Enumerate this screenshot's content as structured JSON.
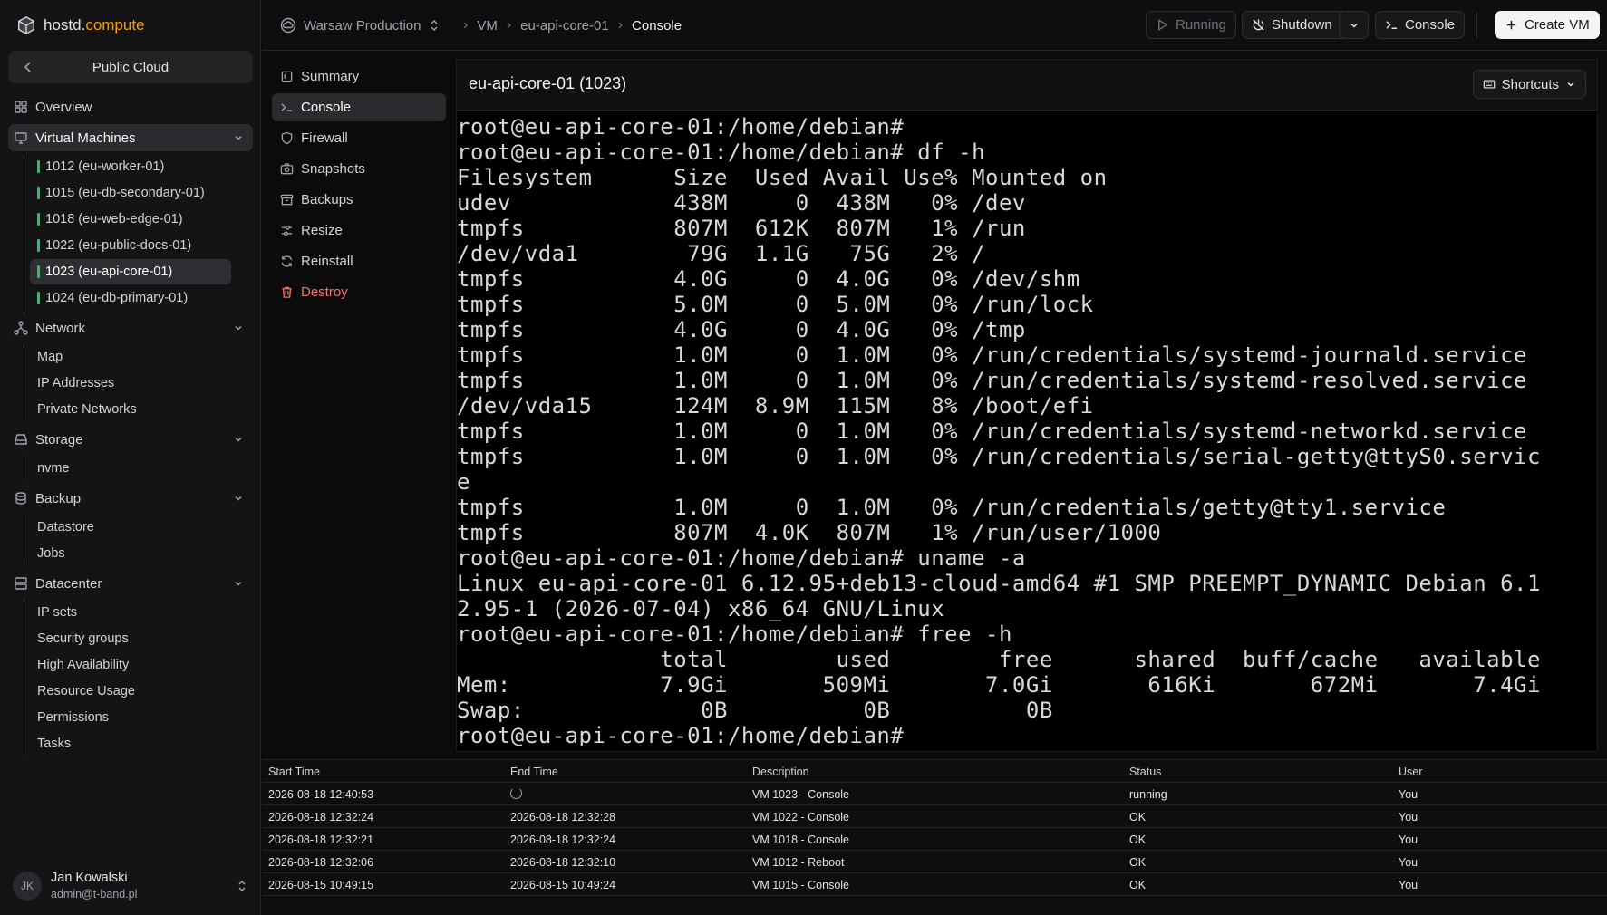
{
  "brand": {
    "name_a": "hostd.",
    "name_b": "compute"
  },
  "scope": {
    "label": "Public Cloud"
  },
  "sidebar": {
    "overview": "Overview",
    "virtual_machines": "Virtual Machines",
    "vms": [
      "1012 (eu-worker-01)",
      "1015 (eu-db-secondary-01)",
      "1018 (eu-web-edge-01)",
      "1022 (eu-public-docs-01)",
      "1023 (eu-api-core-01)",
      "1024 (eu-db-primary-01)"
    ],
    "network": "Network",
    "network_items": [
      "Map",
      "IP Addresses",
      "Private Networks"
    ],
    "storage": "Storage",
    "storage_items": [
      "nvme"
    ],
    "backup": "Backup",
    "backup_items": [
      "Datastore",
      "Jobs"
    ],
    "datacenter": "Datacenter",
    "datacenter_items": [
      "IP sets",
      "Security groups",
      "High Availability",
      "Resource Usage",
      "Permissions",
      "Tasks"
    ]
  },
  "user": {
    "initials": "JK",
    "name": "Jan Kowalski",
    "email": "admin@t-band.pl"
  },
  "topbar": {
    "datacenter": "Warsaw Production",
    "breadcrumb": [
      "VM",
      "eu-api-core-01",
      "Console"
    ],
    "running": "Running",
    "shutdown": "Shutdown",
    "console": "Console",
    "create_vm": "Create VM"
  },
  "subnav": [
    "Summary",
    "Console",
    "Firewall",
    "Snapshots",
    "Backups",
    "Resize",
    "Reinstall",
    "Destroy"
  ],
  "console": {
    "title": "eu-api-core-01 (1023)",
    "shortcuts": "Shortcuts",
    "lines": [
      "root@eu-api-core-01:/home/debian#",
      "root@eu-api-core-01:/home/debian# df -h",
      "Filesystem      Size  Used Avail Use% Mounted on",
      "udev            438M     0  438M   0% /dev",
      "tmpfs           807M  612K  807M   1% /run",
      "/dev/vda1        79G  1.1G   75G   2% /",
      "tmpfs           4.0G     0  4.0G   0% /dev/shm",
      "tmpfs           5.0M     0  5.0M   0% /run/lock",
      "tmpfs           4.0G     0  4.0G   0% /tmp",
      "tmpfs           1.0M     0  1.0M   0% /run/credentials/systemd-journald.service",
      "tmpfs           1.0M     0  1.0M   0% /run/credentials/systemd-resolved.service",
      "/dev/vda15      124M  8.9M  115M   8% /boot/efi",
      "tmpfs           1.0M     0  1.0M   0% /run/credentials/systemd-networkd.service",
      "tmpfs           1.0M     0  1.0M   0% /run/credentials/serial-getty@ttyS0.servic",
      "e",
      "tmpfs           1.0M     0  1.0M   0% /run/credentials/getty@tty1.service",
      "tmpfs           807M  4.0K  807M   1% /run/user/1000",
      "root@eu-api-core-01:/home/debian# uname -a",
      "Linux eu-api-core-01 6.12.95+deb13-cloud-amd64 #1 SMP PREEMPT_DYNAMIC Debian 6.1",
      "2.95-1 (2026-07-04) x86_64 GNU/Linux",
      "root@eu-api-core-01:/home/debian# free -h",
      "               total        used        free      shared  buff/cache   available",
      "Mem:           7.9Gi       509Mi       7.0Gi       616Ki       672Mi       7.4Gi",
      "Swap:             0B          0B          0B",
      "root@eu-api-core-01:/home/debian#"
    ]
  },
  "tasks": {
    "headers": [
      "Start Time",
      "End Time",
      "Description",
      "Status",
      "User"
    ],
    "rows": [
      {
        "start": "2026-08-18 12:40:53",
        "end": "",
        "desc": "VM 1023 - Console",
        "status": "running",
        "user": "You"
      },
      {
        "start": "2026-08-18 12:32:24",
        "end": "2026-08-18 12:32:28",
        "desc": "VM 1022 - Console",
        "status": "OK",
        "user": "You"
      },
      {
        "start": "2026-08-18 12:32:21",
        "end": "2026-08-18 12:32:24",
        "desc": "VM 1018 - Console",
        "status": "OK",
        "user": "You"
      },
      {
        "start": "2026-08-18 12:32:06",
        "end": "2026-08-18 12:32:10",
        "desc": "VM 1012 - Reboot",
        "status": "OK",
        "user": "You"
      },
      {
        "start": "2026-08-15 10:49:15",
        "end": "2026-08-15 10:49:24",
        "desc": "VM 1015 - Console",
        "status": "OK",
        "user": "You"
      }
    ]
  }
}
